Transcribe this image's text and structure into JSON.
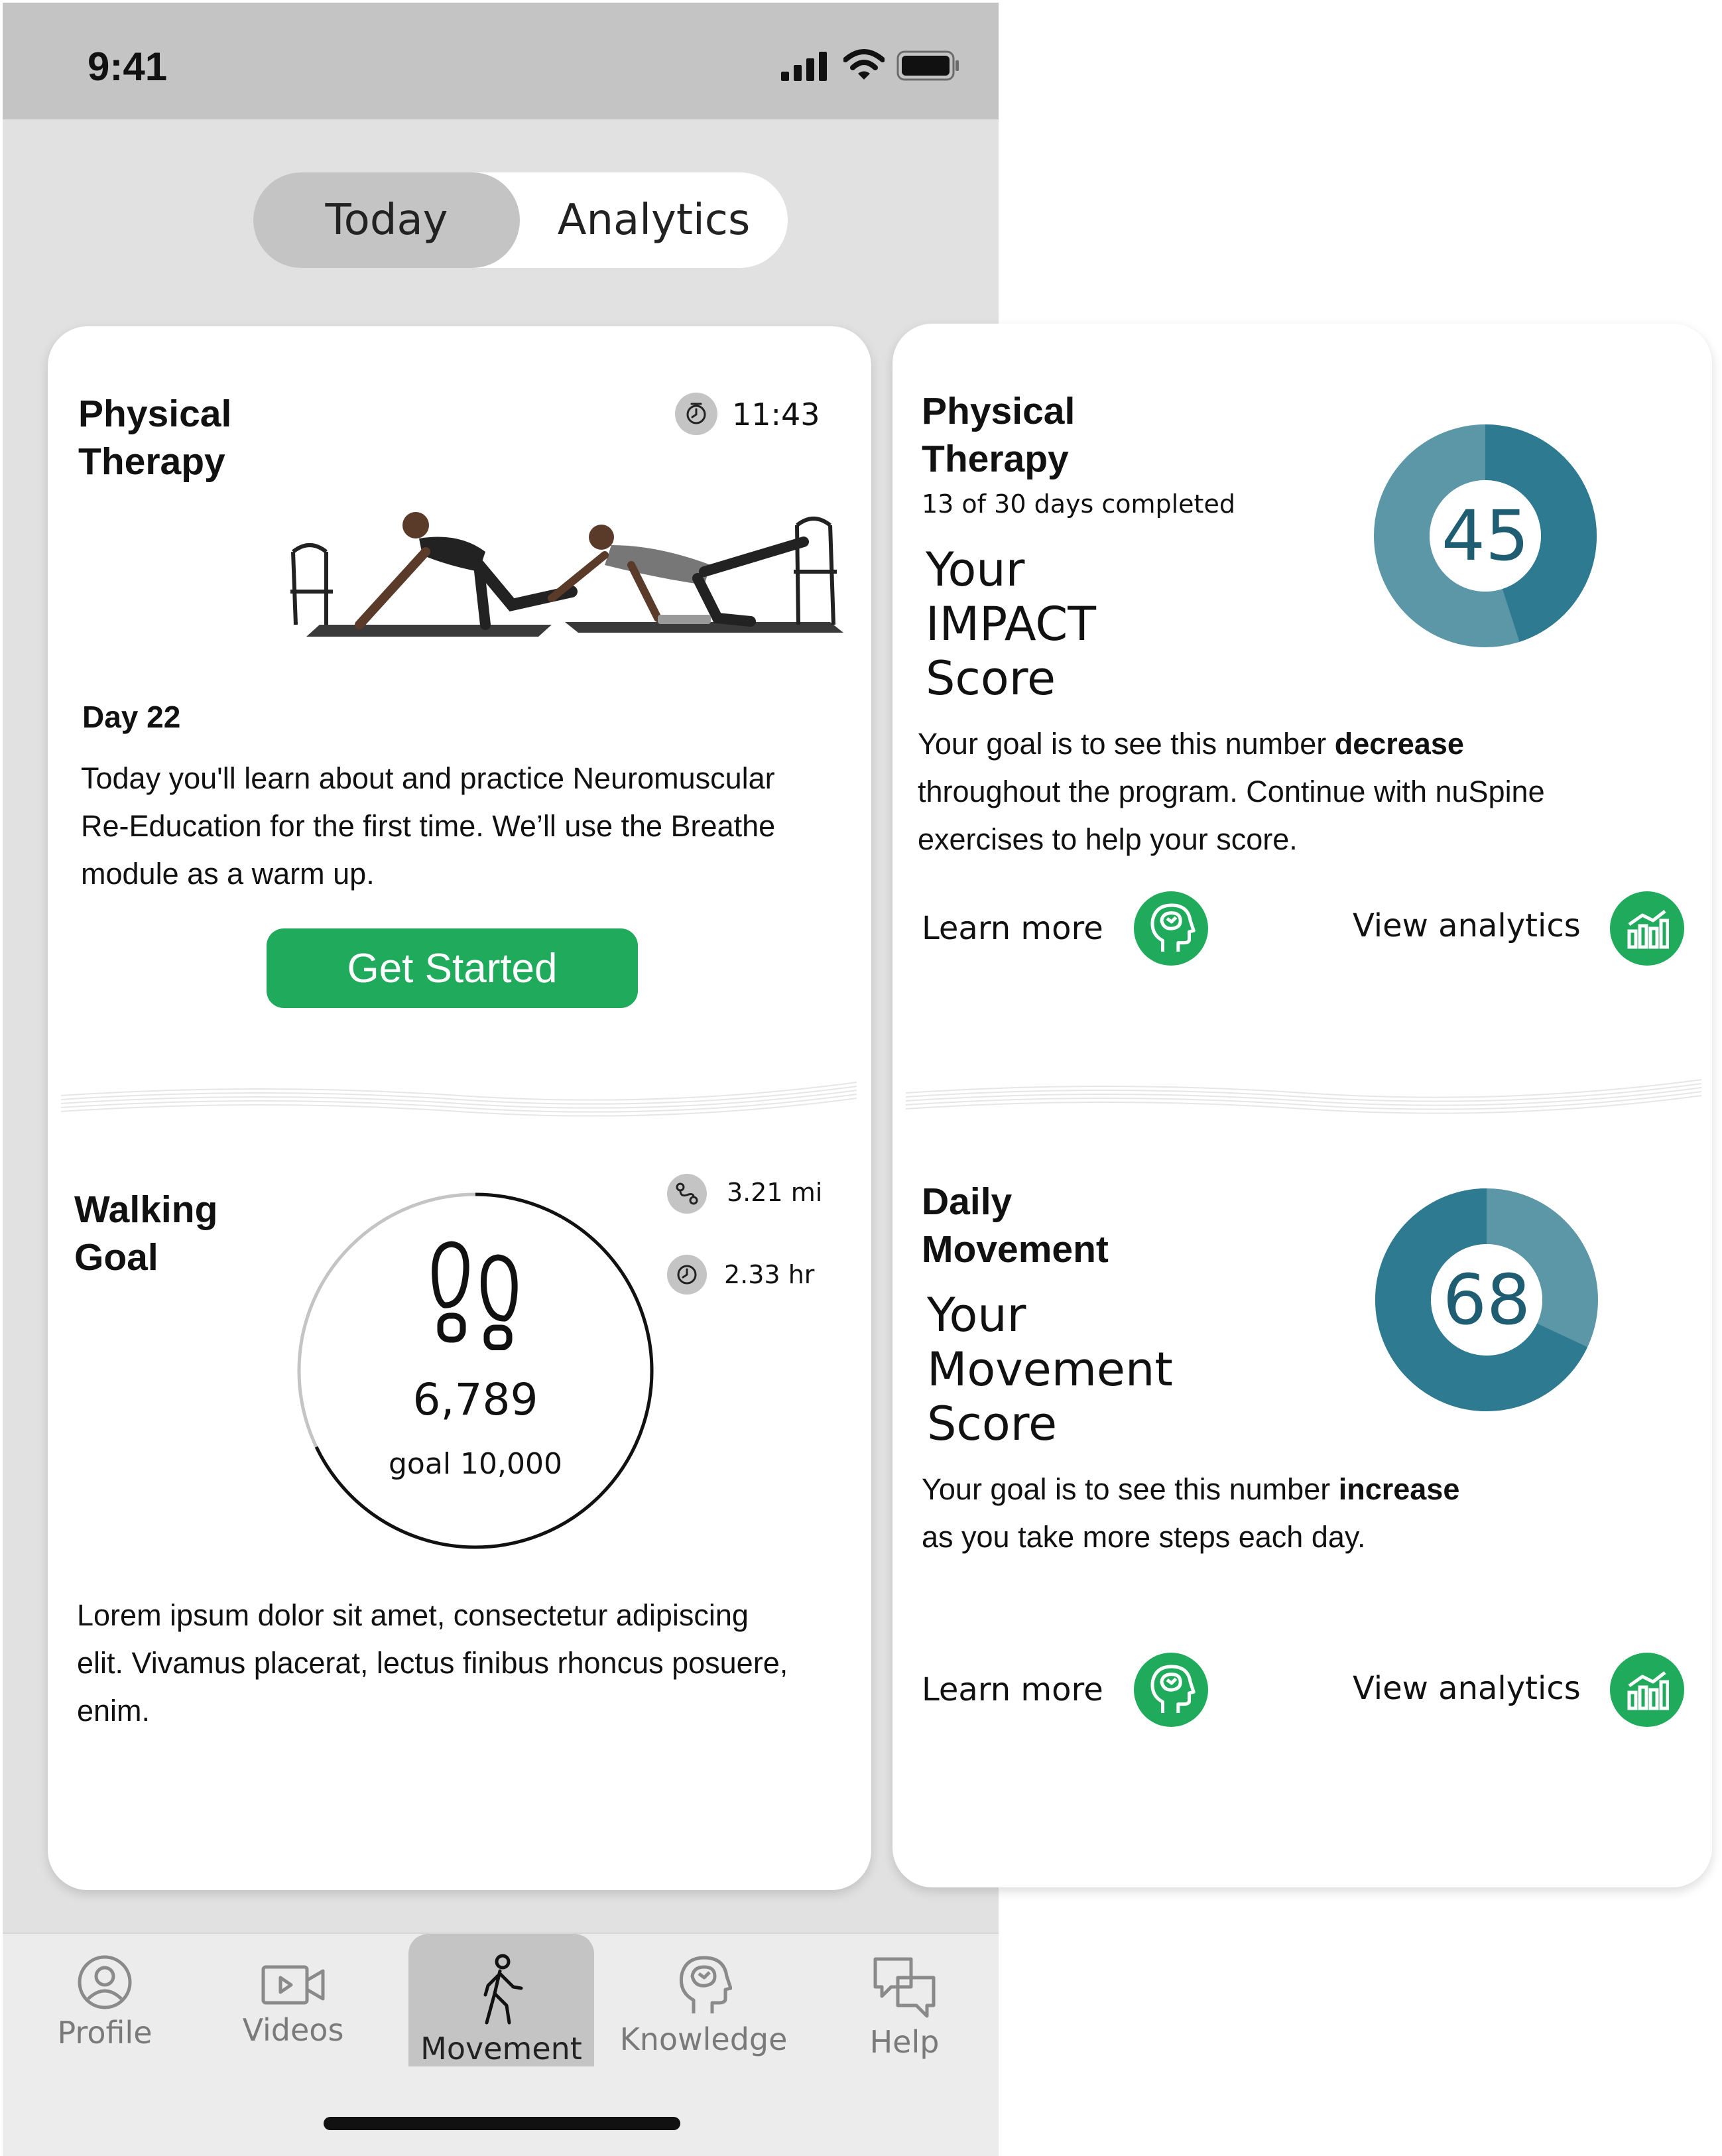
{
  "status_bar": {
    "time": "9:41"
  },
  "segmented_control": {
    "today": "Today",
    "analytics": "Analytics"
  },
  "pt_card": {
    "title_line1": "Physical",
    "title_line2": "Therapy",
    "time": "11:43",
    "day": "Day 22",
    "desc_line1": "Today you'll learn about and practice Neuromuscular",
    "desc_line2": "Re-Education for the first time. We’ll use the Breathe",
    "desc_line3": "module as a warm up.",
    "button": "Get Started"
  },
  "walking_card": {
    "title_line1": "Walking",
    "title_line2": "Goal",
    "distance": "3.21 mi",
    "duration": "2.33 hr",
    "steps": "6,789",
    "goal": "goal 10,000",
    "progress_fraction": 0.6789,
    "desc_line1": "Lorem ipsum dolor sit amet, consectetur adipiscing",
    "desc_line2": "elit. Vivamus placerat, lectus finibus rhoncus posuere,",
    "desc_line3": "enim."
  },
  "impact_card": {
    "title_line1": "Physical",
    "title_line2": "Therapy",
    "progress": "13 of 30 days completed",
    "score_line1": "Your",
    "score_line2": "IMPACT",
    "score_line3": "Score",
    "score": "45",
    "score_fraction": 0.45,
    "desc_line1_pre": "Your goal is to see this number ",
    "desc_line1_bold": "decrease",
    "desc_line2": "throughout the program. Continue with nuSpine",
    "desc_line3": "exercises to help your score.",
    "learn_more": "Learn more",
    "view_analytics": "View analytics"
  },
  "movement_card": {
    "title_line1": "Daily",
    "title_line2": "Movement",
    "score_line1": "Your",
    "score_line2": "Movement",
    "score_line3": "Score",
    "score": "68",
    "score_fraction": 0.68,
    "desc_line1_pre": "Your goal is to see this number ",
    "desc_line1_bold": "increase",
    "desc_line2": "as you take more steps each day.",
    "learn_more": "Learn more",
    "view_analytics": "View analytics"
  },
  "tab_bar": {
    "profile": "Profile",
    "videos": "Videos",
    "movement": "Movement",
    "knowledge": "Knowledge",
    "help": "Help"
  },
  "colors": {
    "accent_green": "#1faa5c",
    "donut_dark": "#2d7a91",
    "donut_light": "#5b97a7",
    "selected_gray": "#c4c4c4"
  }
}
